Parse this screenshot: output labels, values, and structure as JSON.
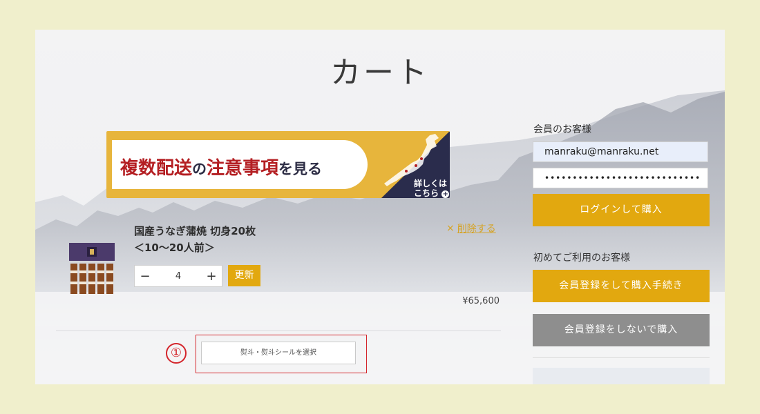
{
  "page": {
    "title": "カート"
  },
  "banner": {
    "text_red1": "複数配送",
    "text_no1": "の",
    "text_red2": "注意事項",
    "text_tail": "を見る",
    "detail_line1": "詳しくは",
    "detail_line2": "こちら"
  },
  "cart": {
    "item": {
      "name_line1": "国産うなぎ蒲焼 切身20枚",
      "name_line2": "＜10〜20人前＞",
      "delete_icon": "×",
      "delete_label": "削除する",
      "quantity": "4",
      "minus": "−",
      "plus": "+",
      "update_label": "更新",
      "price": "¥65,600"
    },
    "annotation_number": "①",
    "noshi_button": "熨斗・熨斗シールを選択"
  },
  "member": {
    "heading": "会員のお客様",
    "email_value": "manraku@manraku.net",
    "password_value": "••••••••••••••••••••••••••••",
    "login_button": "ログインして購入"
  },
  "guest": {
    "heading": "初めてご利用のお客様",
    "register_button": "会員登録をして購入手続き",
    "no_register_button": "会員登録をしないで購入"
  },
  "colors": {
    "accent": "#e2a80f",
    "gray_button": "#8e8e8e",
    "annotation_red": "#d4252b",
    "outer_bg": "#f0efcc"
  }
}
